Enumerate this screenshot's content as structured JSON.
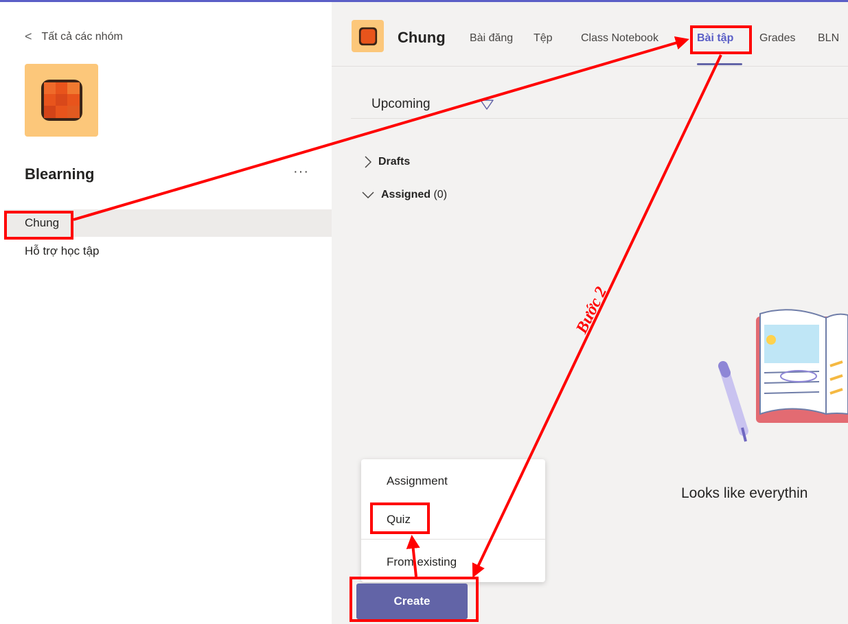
{
  "left_pane": {
    "back_label": "Tất cả các nhóm",
    "team_name": "Blearning",
    "more_label": "···",
    "channels": [
      "Chung",
      "Hỗ trợ học tập"
    ]
  },
  "header": {
    "channel_title": "Chung",
    "tabs": [
      "Bài đăng",
      "Tệp",
      "Class Notebook",
      "Bài tập",
      "Grades",
      "BLN"
    ],
    "active_tab": "Bài tập"
  },
  "assignments": {
    "filter_label": "Upcoming",
    "drafts_label": "Drafts",
    "assigned_label": "Assigned",
    "assigned_count": "(0)",
    "empty_message": "Looks like everythin"
  },
  "create_menu": {
    "items": [
      "Assignment",
      "Quiz",
      "From existing"
    ],
    "create_label": "Create"
  },
  "annotation": {
    "step_label": "Bước 2",
    "color": "#ff0000"
  },
  "colors": {
    "accent": "#6264a7",
    "team_bg": "#fcc77a",
    "team_icon": "#e8541c"
  }
}
